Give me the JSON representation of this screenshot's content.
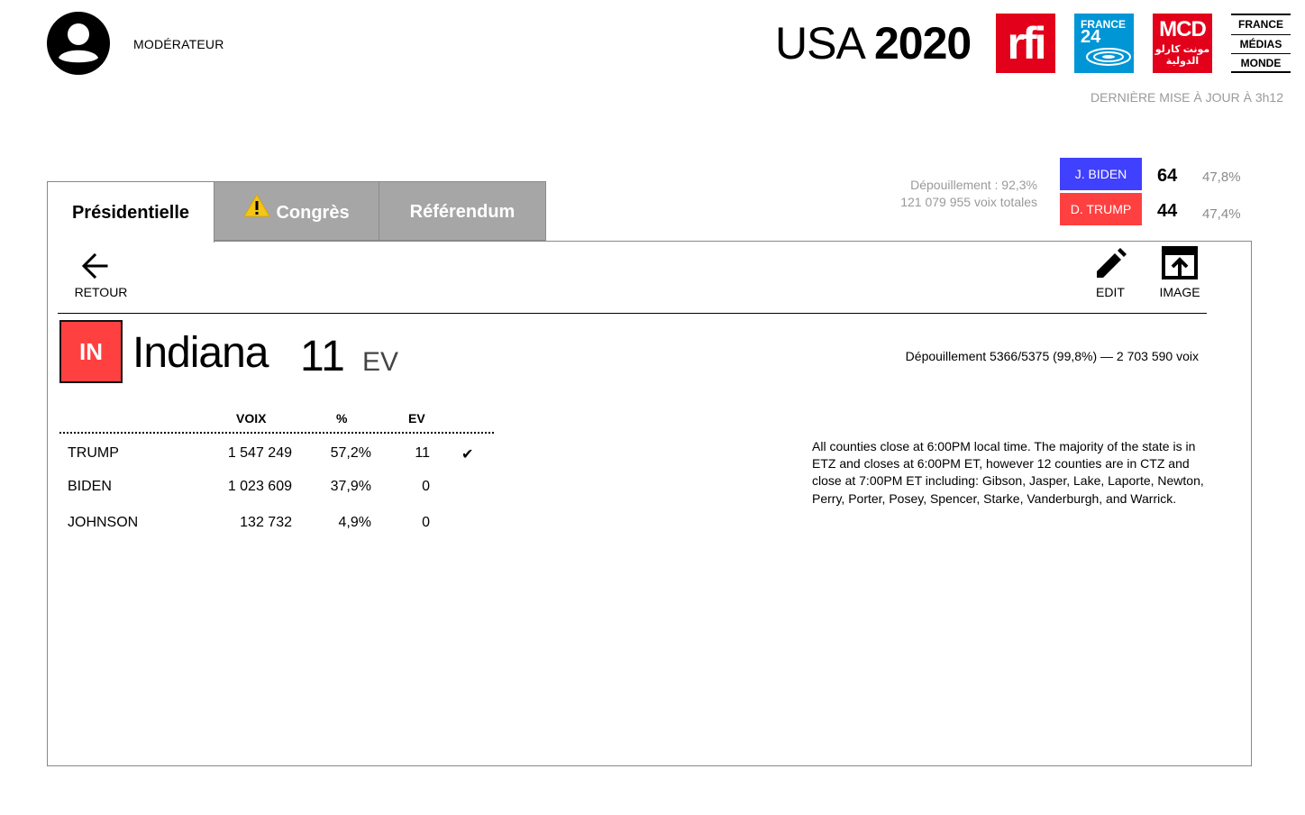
{
  "header": {
    "role": "MODÉRATEUR",
    "title_light": "USA",
    "title_bold": "2020",
    "logos": {
      "rfi": "rfi",
      "france24_line1": "FRANCE",
      "france24_line2": "24",
      "mcd_line1": "MCD",
      "mcd_line2": "مونت كارلو",
      "mcd_line3": "الدولية",
      "fmm": [
        "FRANCE",
        "MÉDIAS",
        "MONDE"
      ]
    },
    "last_update": "DERNIÈRE MISE À JOUR À 3h12"
  },
  "summary": {
    "depouillement": "Dépouillement : 92,3%",
    "total_votes": "121 079 955 voix totales",
    "candidates": [
      {
        "name": "J. BIDEN",
        "ev": "64",
        "pct": "47,8%",
        "color": "#4040ff"
      },
      {
        "name": "D. TRUMP",
        "ev": "44",
        "pct": "47,4%",
        "color": "#ff4040"
      }
    ]
  },
  "tabs": [
    {
      "label": "Présidentielle",
      "active": true
    },
    {
      "label": "Congrès",
      "active": false,
      "icon": "warning-icon"
    },
    {
      "label": "Référendum",
      "active": false
    }
  ],
  "toolbar": {
    "back_label": "RETOUR",
    "edit_label": "EDIT",
    "image_label": "IMAGE"
  },
  "state": {
    "code": "IN",
    "name": "Indiana",
    "ev": "11",
    "ev_unit": "EV",
    "depouillement": "Dépouillement 5366/5375 (99,8%) — 2 703 590 voix",
    "color": "#ff4040"
  },
  "results": {
    "headers": {
      "votes": "VOIX",
      "pct": "%",
      "ev": "EV"
    },
    "rows": [
      {
        "name": "TRUMP",
        "votes": "1 547 249",
        "pct": "57,2%",
        "ev": "11",
        "winner": "✔"
      },
      {
        "name": "BIDEN",
        "votes": "1 023 609",
        "pct": "37,9%",
        "ev": "0",
        "winner": ""
      },
      {
        "name": "JOHNSON",
        "votes": "132 732",
        "pct": "4,9%",
        "ev": "0",
        "winner": ""
      }
    ]
  },
  "note": "All counties close at 6:00PM local time.  The majority of the state is in ETZ and closes at 6:00PM ET, however 12 counties are in CTZ and close at 7:00PM ET including:  Gibson, Jasper, Lake, Laporte, Newton, Perry, Porter, Posey, Spencer, Starke, Vanderburgh, and Warrick."
}
